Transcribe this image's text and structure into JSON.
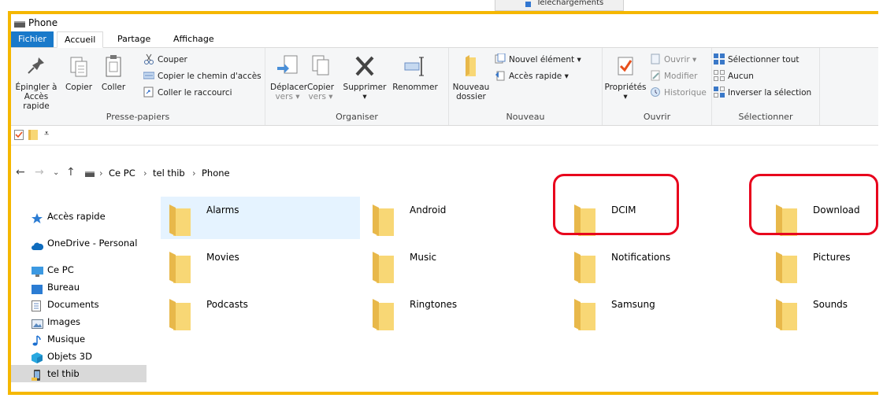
{
  "top_fragment_text": "Téléchargements",
  "window": {
    "title": "Phone"
  },
  "tabs": [
    {
      "label": "Fichier"
    },
    {
      "label": "Accueil"
    },
    {
      "label": "Partage"
    },
    {
      "label": "Affichage"
    }
  ],
  "ribbon": {
    "presse_papiers": {
      "label": "Presse-papiers",
      "epingler_1": "Épingler à",
      "epingler_2": "Accès rapide",
      "copier": "Copier",
      "coller": "Coller",
      "couper": "Couper",
      "copier_chemin": "Copier le chemin d'accès",
      "coller_raccourci": "Coller le raccourci"
    },
    "organiser": {
      "label": "Organiser",
      "deplacer_1": "Déplacer",
      "deplacer_2": "vers",
      "copier_1": "Copier",
      "copier_2": "vers",
      "supprimer": "Supprimer",
      "renommer": "Renommer"
    },
    "nouveau": {
      "label": "Nouveau",
      "nouveau_1": "Nouveau",
      "nouveau_2": "dossier",
      "nouvel_element": "Nouvel élément",
      "acces_rapide": "Accès rapide"
    },
    "ouvrir": {
      "label": "Ouvrir",
      "proprietes": "Propriétés",
      "ouvrir": "Ouvrir",
      "modifier": "Modifier",
      "historique": "Historique"
    },
    "selectionner": {
      "label": "Sélectionner",
      "tout": "Sélectionner tout",
      "aucun": "Aucun",
      "inverser": "Inverser la sélection"
    }
  },
  "breadcrumb": [
    "Ce PC",
    "tel thib",
    "Phone"
  ],
  "sidebar": [
    {
      "label": "Accès rapide",
      "icon": "star-icon"
    },
    {
      "label": "OneDrive - Personal",
      "icon": "cloud-icon"
    },
    {
      "label": "Ce PC",
      "icon": "monitor-icon"
    },
    {
      "label": "Bureau",
      "icon": "desktop-icon"
    },
    {
      "label": "Documents",
      "icon": "document-icon"
    },
    {
      "label": "Images",
      "icon": "images-icon"
    },
    {
      "label": "Musique",
      "icon": "music-icon"
    },
    {
      "label": "Objets 3D",
      "icon": "cube-icon"
    },
    {
      "label": "tel thib",
      "icon": "phone-icon"
    }
  ],
  "folders": [
    {
      "name": "Alarms",
      "selected": true
    },
    {
      "name": "Android"
    },
    {
      "name": "DCIM",
      "highlighted": true
    },
    {
      "name": "Download",
      "highlighted": true
    },
    {
      "name": "Movies"
    },
    {
      "name": "Music"
    },
    {
      "name": "Notifications"
    },
    {
      "name": "Pictures"
    },
    {
      "name": "Podcasts"
    },
    {
      "name": "Ringtones"
    },
    {
      "name": "Samsung"
    },
    {
      "name": "Sounds"
    }
  ],
  "colors": {
    "frame_highlight": "#f5b700",
    "annotation_red": "#e8001c",
    "fichier_tab": "#1979ca",
    "selection": "#e5f3ff",
    "folder_yellow": "#f8d775"
  }
}
